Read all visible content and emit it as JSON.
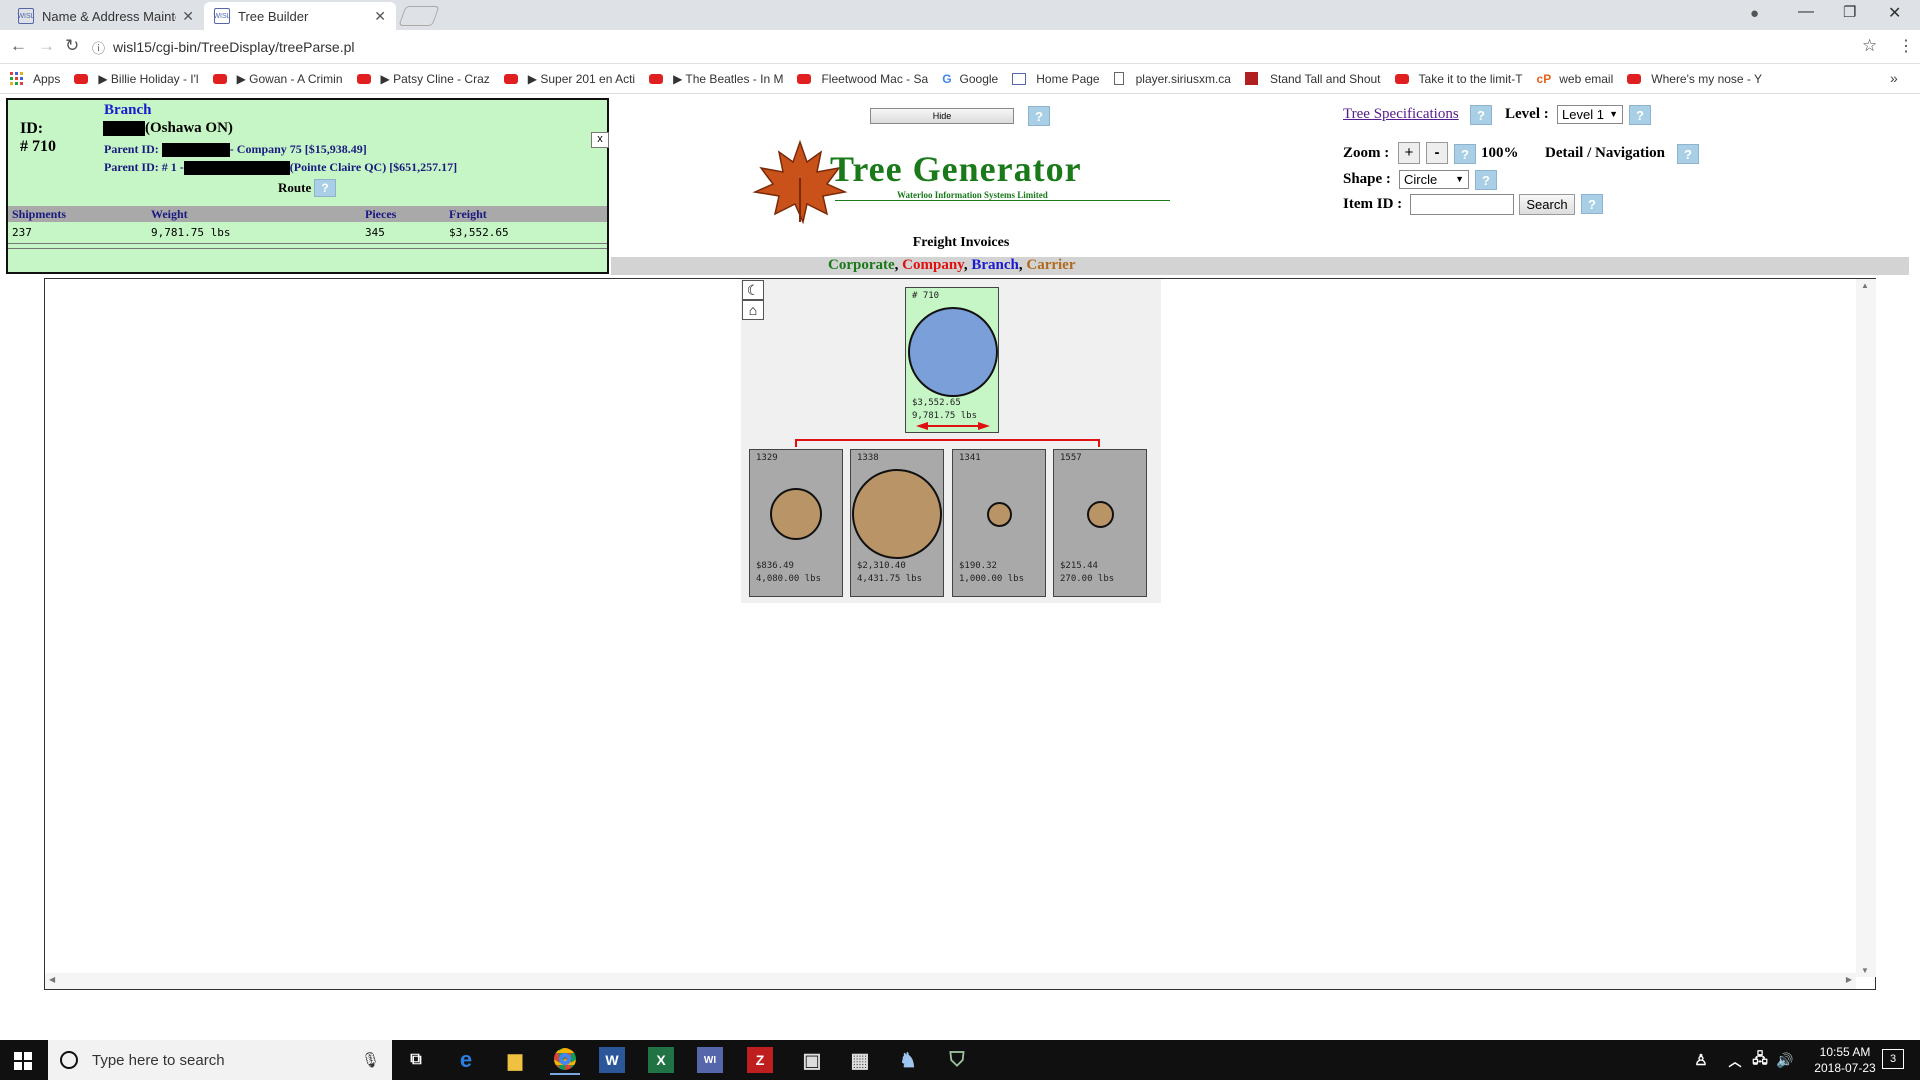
{
  "browser": {
    "tabs": [
      {
        "label": "Name & Address Mainte",
        "active": false
      },
      {
        "label": "Tree Builder",
        "active": true
      }
    ],
    "url": "wisl15/cgi-bin/TreeDisplay/treeParse.pl",
    "bookmarks": [
      {
        "label": "Apps",
        "icon": "apps-grid-icon"
      },
      {
        "label": "▶ Billie Holiday - I'l",
        "icon": "youtube-icon"
      },
      {
        "label": "▶ Gowan - A Crimin",
        "icon": "youtube-icon"
      },
      {
        "label": "▶ Patsy Cline - Craz",
        "icon": "youtube-icon"
      },
      {
        "label": "▶ Super 201 en Acti",
        "icon": "youtube-icon"
      },
      {
        "label": "▶ The Beatles - In M",
        "icon": "youtube-icon"
      },
      {
        "label": "Fleetwood Mac - Sa",
        "icon": "youtube-icon"
      },
      {
        "label": "Google",
        "icon": "google-icon"
      },
      {
        "label": "Home Page",
        "icon": "wisl-icon"
      },
      {
        "label": "player.siriusxm.ca",
        "icon": "page-icon"
      },
      {
        "label": "Stand Tall and Shout",
        "icon": "app-icon"
      },
      {
        "label": "Take it to the limit-T",
        "icon": "youtube-icon"
      },
      {
        "label": "web email",
        "icon": "cpanel-icon"
      },
      {
        "label": "Where's my nose - Y",
        "icon": "youtube-icon"
      }
    ]
  },
  "info_panel": {
    "type_label": "Branch",
    "id_label": "ID:",
    "id_value": "(Oshawa ON)",
    "number": "# 710",
    "parent1_prefix": "Parent ID:",
    "parent1_suffix": "- Company 75 [$15,938.49]",
    "parent2_prefix": "Parent ID: # 1 -",
    "parent2_suffix": "(Pointe Claire QC) [$651,257.17]",
    "route_label": "Route",
    "close_label": "x",
    "help_label": "?",
    "columns": [
      "Shipments",
      "Weight",
      "Pieces",
      "Freight"
    ],
    "row": [
      "237",
      "9,781.75 lbs",
      "345",
      "$3,552.65"
    ]
  },
  "header": {
    "hide_label": "Hide",
    "logo_title": "Tree Generator",
    "logo_subtitle": "Waterloo Information Systems Limited",
    "section_title": "Freight Invoices",
    "legend": [
      {
        "label": "Corporate",
        "color": "#1a7a1a"
      },
      {
        "label": "Company",
        "color": "#e01010"
      },
      {
        "label": "Branch",
        "color": "#1a1ad0"
      },
      {
        "label": "Carrier",
        "color": "#b06a1a"
      }
    ],
    "legend_sep": ","
  },
  "controls": {
    "tree_specs_label": "Tree Specifications",
    "level_label": "Level :",
    "level_value": "Level 1",
    "zoom_label": "Zoom :",
    "zoom_in": "+",
    "zoom_out": "-",
    "zoom_value": "100%",
    "detail_label": "Detail / Navigation",
    "shape_label": "Shape :",
    "shape_value": "Circle",
    "item_id_label": "Item ID :",
    "item_id_value": "",
    "search_label": "Search",
    "help_label": "?"
  },
  "tree": {
    "root": {
      "id": "# 710",
      "freight": "$3,552.65",
      "weight": "9,781.75 lbs",
      "fill": "#7b9fd9",
      "bg": "#c6f6c6"
    },
    "children": [
      {
        "id": "1329",
        "freight": "$836.49",
        "weight": "4,080.00 lbs",
        "size": 0.57
      },
      {
        "id": "1338",
        "freight": "$2,310.40",
        "weight": "4,431.75 lbs",
        "size": 1.0
      },
      {
        "id": "1341",
        "freight": "$190.32",
        "weight": "1,000.00 lbs",
        "size": 0.27
      },
      {
        "id": "1557",
        "freight": "$215.44",
        "weight": "270.00 lbs",
        "size": 0.29
      }
    ],
    "child_fill": "#b99466",
    "child_bg": "#a9a9a9",
    "connector_color": "#e01010"
  },
  "taskbar": {
    "search_placeholder": "Type here to search",
    "time": "10:55 AM",
    "date": "2018-07-23",
    "notification_count": "3"
  }
}
